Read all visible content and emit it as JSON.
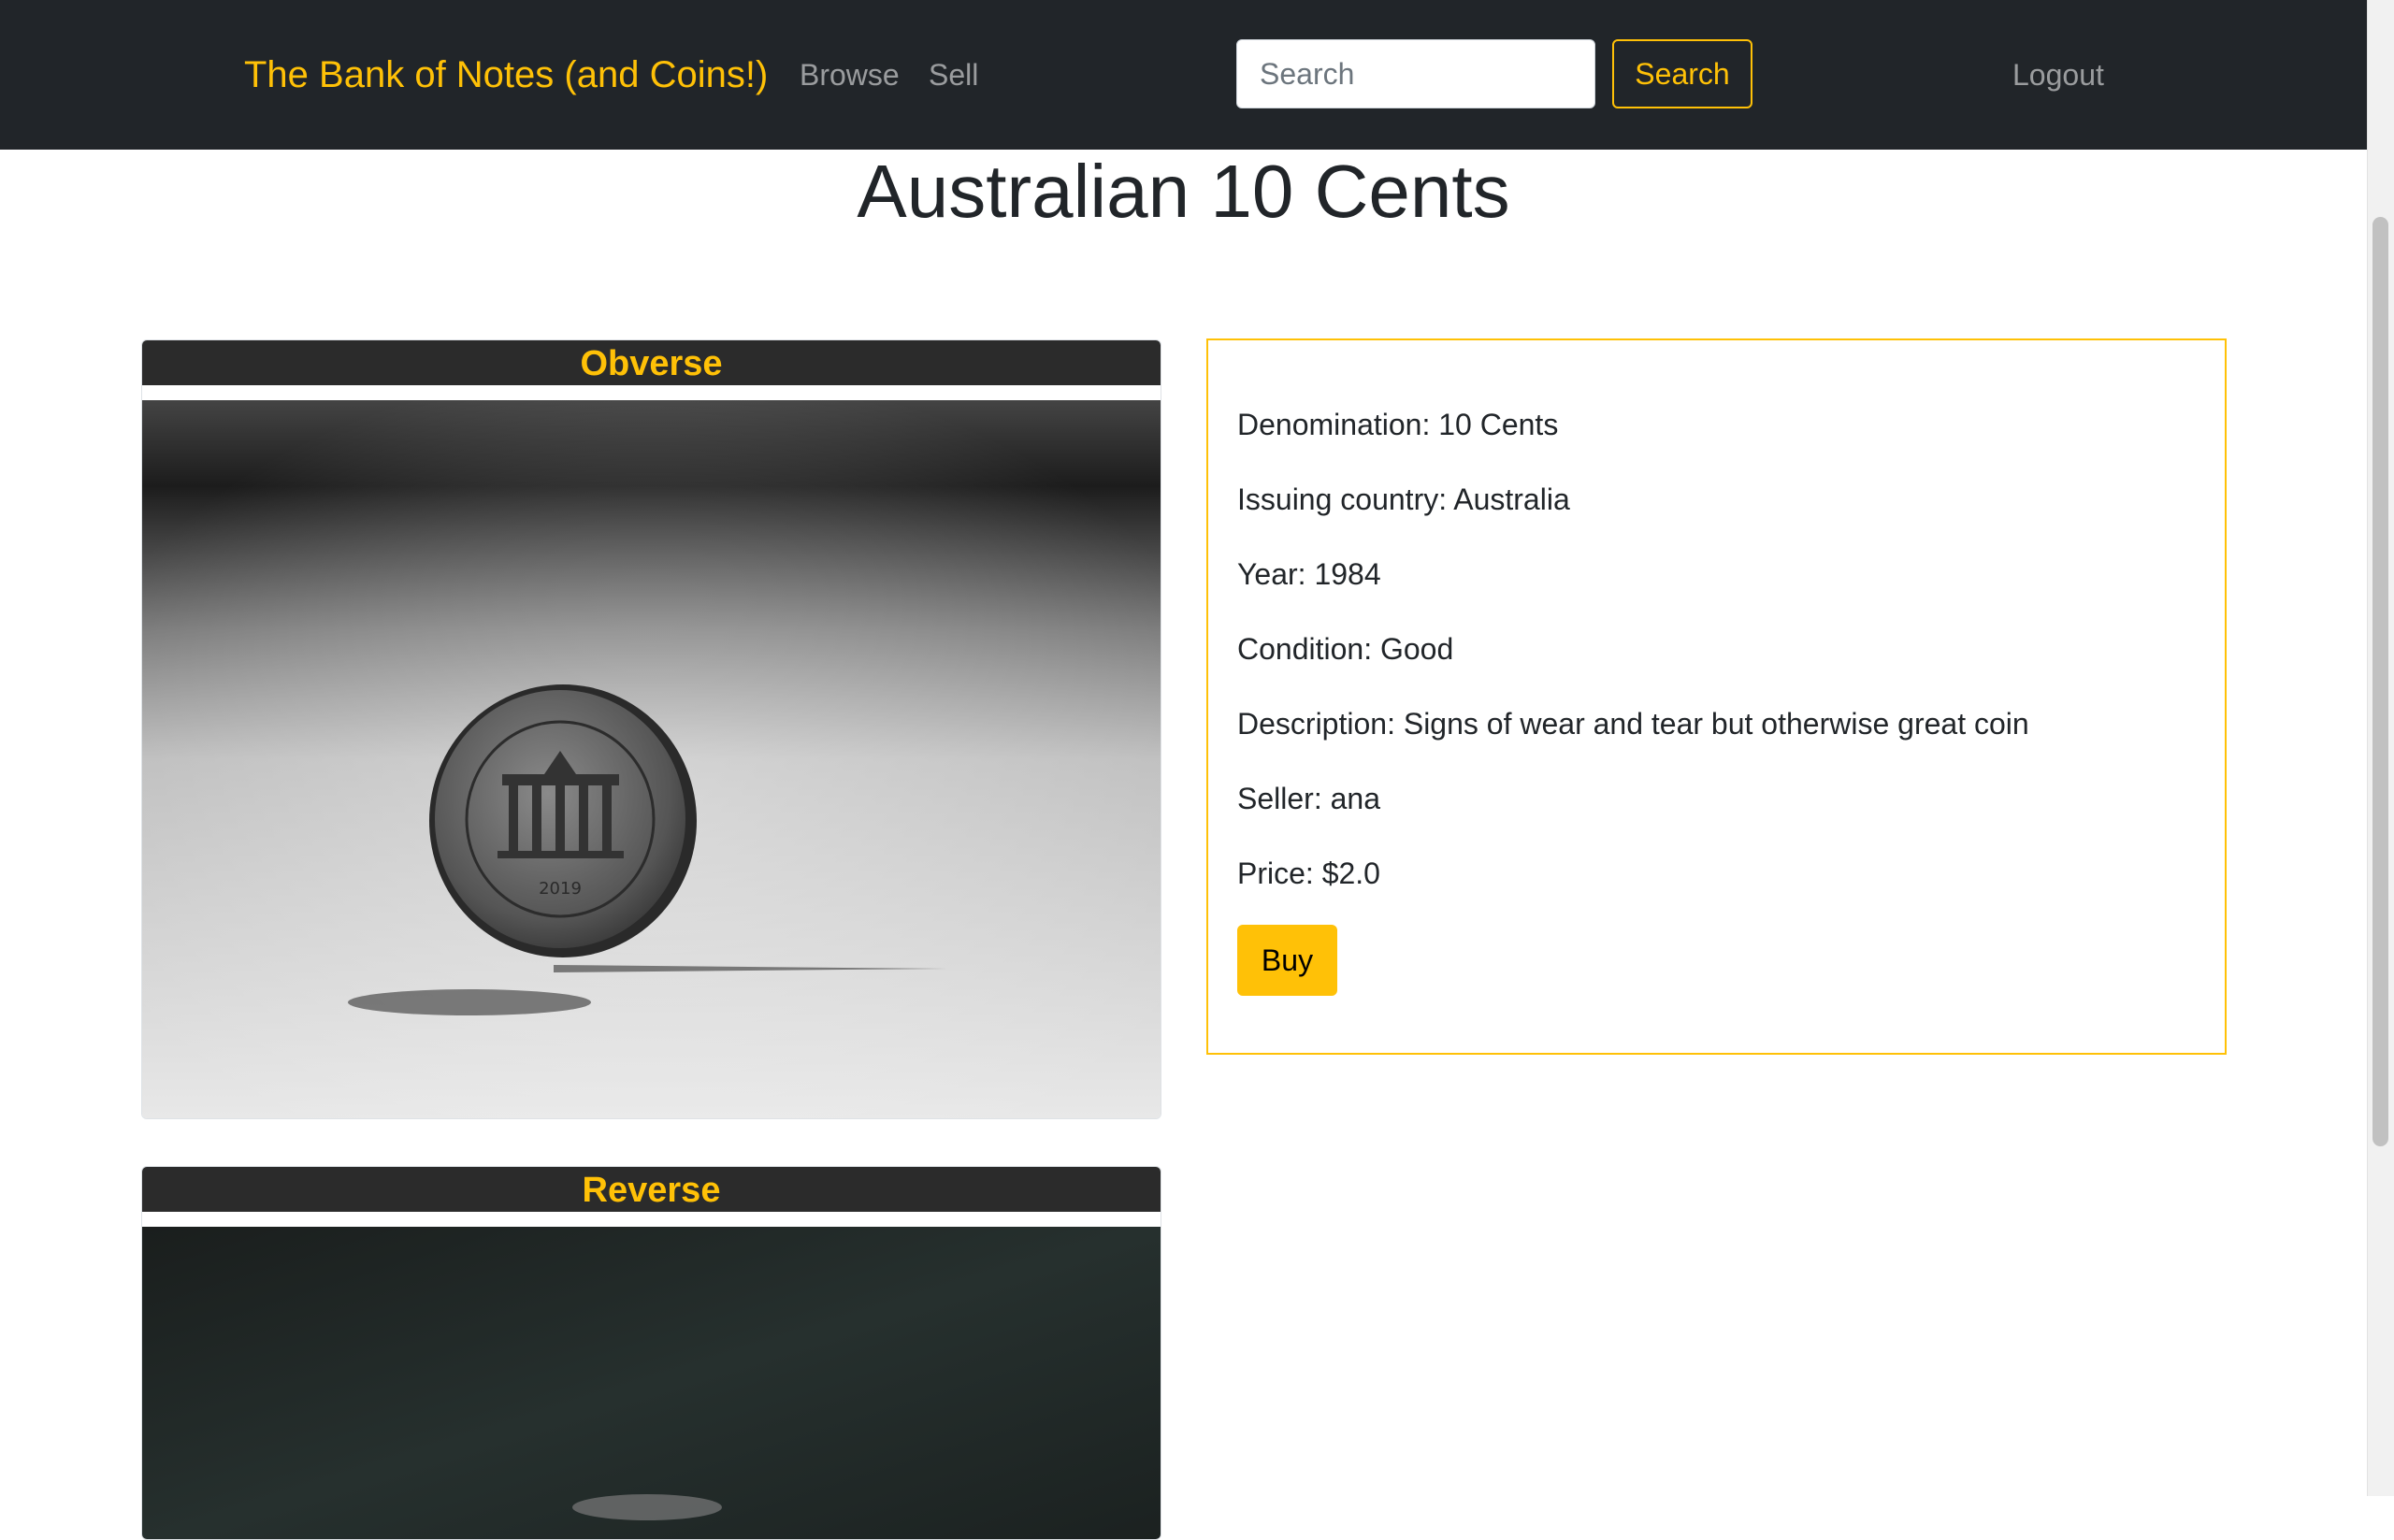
{
  "navbar": {
    "brand": "The Bank of Notes (and Coins!)",
    "links": [
      {
        "label": "Browse"
      },
      {
        "label": "Sell"
      }
    ],
    "search": {
      "placeholder": "Search",
      "value": "",
      "button_label": "Search"
    },
    "logout_label": "Logout"
  },
  "page": {
    "title": "Australian 10 Cents"
  },
  "images": {
    "obverse_header": "Obverse",
    "reverse_header": "Reverse"
  },
  "details": {
    "denomination": "Denomination: 10 Cents",
    "issuing_country": "Issuing country: Australia",
    "year": "Year: 1984",
    "condition": "Condition: Good",
    "description": "Description: Signs of wear and tear but otherwise great coin",
    "seller": "Seller: ana",
    "price": "Price: $2.0",
    "buy_label": "Buy"
  },
  "colors": {
    "accent": "#ffc107",
    "navbar_bg": "#212529"
  }
}
